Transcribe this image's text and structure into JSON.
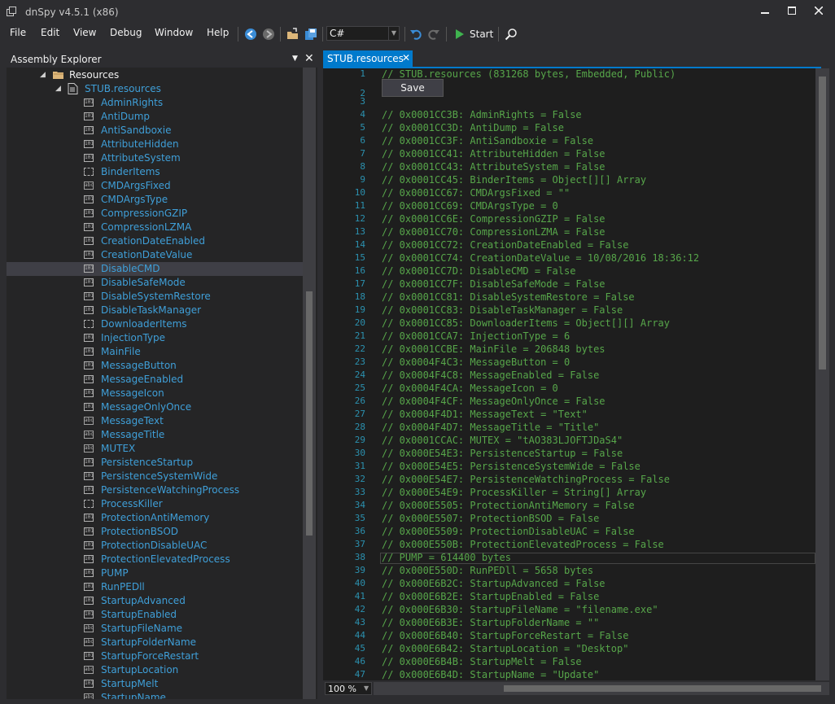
{
  "window": {
    "title": "dnSpy v4.5.1 (x86)"
  },
  "menu": [
    "File",
    "Edit",
    "View",
    "Debug",
    "Window",
    "Help"
  ],
  "toolbar": {
    "language": "C#",
    "start_label": "Start"
  },
  "assembly_explorer": {
    "title": "Assembly Explorer",
    "folder_label": "Resources",
    "resource_file": "STUB.resources",
    "items": [
      {
        "label": "AdminRights",
        "icon": "bin"
      },
      {
        "label": "AntiDump",
        "icon": "bin"
      },
      {
        "label": "AntiSandboxie",
        "icon": "bin"
      },
      {
        "label": "AttributeHidden",
        "icon": "bin"
      },
      {
        "label": "AttributeSystem",
        "icon": "bin"
      },
      {
        "label": "BinderItems",
        "icon": "obj"
      },
      {
        "label": "CMDArgsFixed",
        "icon": "abc"
      },
      {
        "label": "CMDArgsType",
        "icon": "bin"
      },
      {
        "label": "CompressionGZIP",
        "icon": "bin"
      },
      {
        "label": "CompressionLZMA",
        "icon": "bin"
      },
      {
        "label": "CreationDateEnabled",
        "icon": "bin"
      },
      {
        "label": "CreationDateValue",
        "icon": "bin"
      },
      {
        "label": "DisableCMD",
        "icon": "bin",
        "selected": true
      },
      {
        "label": "DisableSafeMode",
        "icon": "bin"
      },
      {
        "label": "DisableSystemRestore",
        "icon": "bin"
      },
      {
        "label": "DisableTaskManager",
        "icon": "bin"
      },
      {
        "label": "DownloaderItems",
        "icon": "obj"
      },
      {
        "label": "InjectionType",
        "icon": "bin"
      },
      {
        "label": "MainFile",
        "icon": "bin"
      },
      {
        "label": "MessageButton",
        "icon": "bin"
      },
      {
        "label": "MessageEnabled",
        "icon": "bin"
      },
      {
        "label": "MessageIcon",
        "icon": "bin"
      },
      {
        "label": "MessageOnlyOnce",
        "icon": "bin"
      },
      {
        "label": "MessageText",
        "icon": "abc"
      },
      {
        "label": "MessageTitle",
        "icon": "abc"
      },
      {
        "label": "MUTEX",
        "icon": "abc"
      },
      {
        "label": "PersistenceStartup",
        "icon": "bin"
      },
      {
        "label": "PersistenceSystemWide",
        "icon": "bin"
      },
      {
        "label": "PersistenceWatchingProcess",
        "icon": "bin"
      },
      {
        "label": "ProcessKiller",
        "icon": "obj"
      },
      {
        "label": "ProtectionAntiMemory",
        "icon": "bin"
      },
      {
        "label": "ProtectionBSOD",
        "icon": "bin"
      },
      {
        "label": "ProtectionDisableUAC",
        "icon": "bin"
      },
      {
        "label": "ProtectionElevatedProcess",
        "icon": "bin"
      },
      {
        "label": "PUMP",
        "icon": "bin"
      },
      {
        "label": "RunPEDll",
        "icon": "bin"
      },
      {
        "label": "StartupAdvanced",
        "icon": "bin"
      },
      {
        "label": "StartupEnabled",
        "icon": "bin"
      },
      {
        "label": "StartupFileName",
        "icon": "abc"
      },
      {
        "label": "StartupFolderName",
        "icon": "abc"
      },
      {
        "label": "StartupForceRestart",
        "icon": "bin"
      },
      {
        "label": "StartupLocation",
        "icon": "abc"
      },
      {
        "label": "StartupMelt",
        "icon": "bin"
      },
      {
        "label": "StartupName",
        "icon": "abc"
      }
    ]
  },
  "editor": {
    "tab_label": "STUB.resources",
    "save_label": "Save",
    "current_line": "38",
    "lines": [
      {
        "n": "1",
        "t": "// STUB.resources (831268 bytes, Embedded, Public)"
      },
      {
        "n": "2",
        "t": ""
      },
      {
        "n": "3",
        "t": ""
      },
      {
        "n": "4",
        "t": "// 0x0001CC3B: AdminRights = False"
      },
      {
        "n": "5",
        "t": "// 0x0001CC3D: AntiDump = False"
      },
      {
        "n": "6",
        "t": "// 0x0001CC3F: AntiSandboxie = False"
      },
      {
        "n": "7",
        "t": "// 0x0001CC41: AttributeHidden = False"
      },
      {
        "n": "8",
        "t": "// 0x0001CC43: AttributeSystem = False"
      },
      {
        "n": "9",
        "t": "// 0x0001CC45: BinderItems = Object[][] Array"
      },
      {
        "n": "10",
        "t": "// 0x0001CC67: CMDArgsFixed = \"\""
      },
      {
        "n": "11",
        "t": "// 0x0001CC69: CMDArgsType = 0"
      },
      {
        "n": "12",
        "t": "// 0x0001CC6E: CompressionGZIP = False"
      },
      {
        "n": "13",
        "t": "// 0x0001CC70: CompressionLZMA = False"
      },
      {
        "n": "14",
        "t": "// 0x0001CC72: CreationDateEnabled = False"
      },
      {
        "n": "15",
        "t": "// 0x0001CC74: CreationDateValue = 10/08/2016 18:36:12"
      },
      {
        "n": "16",
        "t": "// 0x0001CC7D: DisableCMD = False"
      },
      {
        "n": "17",
        "t": "// 0x0001CC7F: DisableSafeMode = False"
      },
      {
        "n": "18",
        "t": "// 0x0001CC81: DisableSystemRestore = False"
      },
      {
        "n": "19",
        "t": "// 0x0001CC83: DisableTaskManager = False"
      },
      {
        "n": "20",
        "t": "// 0x0001CC85: DownloaderItems = Object[][] Array"
      },
      {
        "n": "21",
        "t": "// 0x0001CCA7: InjectionType = 6"
      },
      {
        "n": "22",
        "t": "// 0x0001CCBE: MainFile = 206848 bytes"
      },
      {
        "n": "23",
        "t": "// 0x0004F4C3: MessageButton = 0"
      },
      {
        "n": "24",
        "t": "// 0x0004F4C8: MessageEnabled = False"
      },
      {
        "n": "25",
        "t": "// 0x0004F4CA: MessageIcon = 0"
      },
      {
        "n": "26",
        "t": "// 0x0004F4CF: MessageOnlyOnce = False"
      },
      {
        "n": "27",
        "t": "// 0x0004F4D1: MessageText = \"Text\""
      },
      {
        "n": "28",
        "t": "// 0x0004F4D7: MessageTitle = \"Title\""
      },
      {
        "n": "29",
        "t": "// 0x0001CCAC: MUTEX = \"tAO383LJOFTJDaS4\""
      },
      {
        "n": "30",
        "t": "// 0x000E54E3: PersistenceStartup = False"
      },
      {
        "n": "31",
        "t": "// 0x000E54E5: PersistenceSystemWide = False"
      },
      {
        "n": "32",
        "t": "// 0x000E54E7: PersistenceWatchingProcess = False"
      },
      {
        "n": "33",
        "t": "// 0x000E54E9: ProcessKiller = String[] Array"
      },
      {
        "n": "34",
        "t": "// 0x000E5505: ProtectionAntiMemory = False"
      },
      {
        "n": "35",
        "t": "// 0x000E5507: ProtectionBSOD = False"
      },
      {
        "n": "36",
        "t": "// 0x000E5509: ProtectionDisableUAC = False"
      },
      {
        "n": "37",
        "t": "// 0x000E550B: ProtectionElevatedProcess = False"
      },
      {
        "n": "38",
        "t": "// PUMP = 614400 bytes"
      },
      {
        "n": "39",
        "t": "// 0x000E550D: RunPEDll = 5658 bytes"
      },
      {
        "n": "40",
        "t": "// 0x000E6B2C: StartupAdvanced = False"
      },
      {
        "n": "41",
        "t": "// 0x000E6B2E: StartupEnabled = False"
      },
      {
        "n": "42",
        "t": "// 0x000E6B30: StartupFileName = \"filename.exe\""
      },
      {
        "n": "43",
        "t": "// 0x000E6B3E: StartupFolderName = \"\""
      },
      {
        "n": "44",
        "t": "// 0x000E6B40: StartupForceRestart = False"
      },
      {
        "n": "45",
        "t": "// 0x000E6B42: StartupLocation = \"Desktop\""
      },
      {
        "n": "46",
        "t": "// 0x000E6B4B: StartupMelt = False"
      },
      {
        "n": "47",
        "t": "// 0x000E6B4D: StartupName = \"Update\""
      }
    ]
  },
  "status": {
    "zoom": "100 %"
  }
}
